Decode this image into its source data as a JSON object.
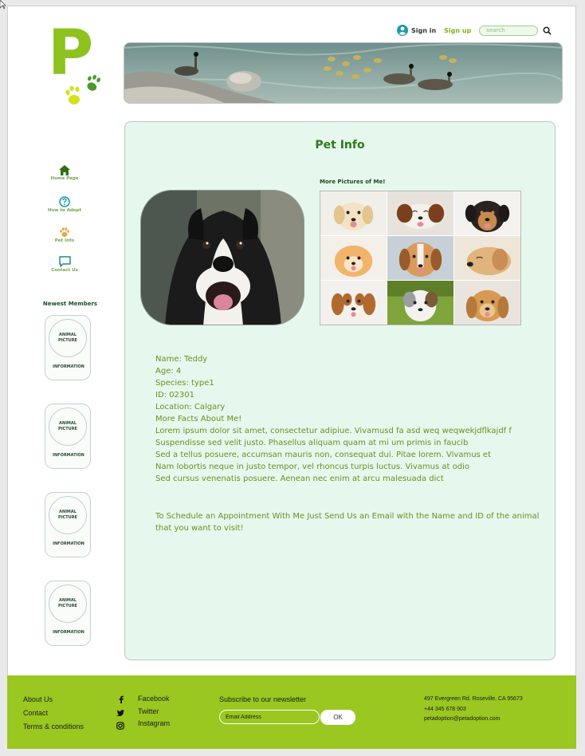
{
  "header": {
    "logo_letter": "P",
    "signin_label": "Sign in",
    "signup_label": "Sign up",
    "search_placeholder": "search"
  },
  "nav": [
    {
      "label": "Home Page",
      "icon": "home-icon"
    },
    {
      "label": "How to Adopt",
      "icon": "question-icon"
    },
    {
      "label": "Pet Info",
      "icon": "paw-icon"
    },
    {
      "label": "Contact Us",
      "icon": "chat-icon"
    }
  ],
  "newest": {
    "title": "Newest Members",
    "cards": [
      {
        "picture_line1": "ANIMAL",
        "picture_line2": "PICTURE",
        "info": "INFORMATION"
      },
      {
        "picture_line1": "ANIMAL",
        "picture_line2": "PICTURE",
        "info": "INFORMATION"
      },
      {
        "picture_line1": "ANIMAL",
        "picture_line2": "PICTURE",
        "info": "INFORMATION"
      },
      {
        "picture_line1": "ANIMAL",
        "picture_line2": "PICTURE",
        "info": "INFORMATION"
      }
    ]
  },
  "main": {
    "title": "Pet Info",
    "more_pictures_title": "More Pictures of Me!",
    "details": [
      "Name: Teddy",
      "Age: 4",
      "Species: type1",
      "ID: 02301",
      "Location: Calgary",
      "More Facts About Me!",
      "Lorem ipsum dolor sit amet, consectetur adipiue. Vivamusd fa asd weq weqwekjdflkajdf f",
      "Suspendisse sed velit justo. Phasellus aliquam quam at mi um primis in faucib",
      "Sed a tellus posuere, accumsan mauris non, consequat dui. Pitae lorem. Vivamus et",
      "Nam lobortis neque in justo tempor, vel rhoncus turpis luctus. Vivamus at odio",
      "Sed cursus venenatis posuere. Aenean nec enim at arcu malesuada dict"
    ],
    "schedule_text": "To Schedule an Appointment With Me Just Send Us an Email with the Name and ID of the animal that you want to visit!"
  },
  "footer": {
    "links": [
      "About Us",
      "Contact",
      "Terms & conditions"
    ],
    "social": [
      {
        "label": "Facebook",
        "icon": "facebook-icon"
      },
      {
        "label": "Twitter",
        "icon": "twitter-icon"
      },
      {
        "label": "Instagram",
        "icon": "instagram-icon"
      }
    ],
    "newsletter_title": "Subscribe to our newsletter",
    "email_placeholder": "Email Address",
    "ok_label": "OK",
    "address_lines": [
      "497 Evergreen Rd. Roseville, CA 95673",
      "+44 345 678 903",
      "petadoption@petadoption.com"
    ]
  },
  "colors": {
    "brand_green": "#8dc21f",
    "footer_green": "#9ac720",
    "panel_bg": "#e6f8ee",
    "title_green": "#2f7a18",
    "text_green": "#6a8f1e"
  }
}
